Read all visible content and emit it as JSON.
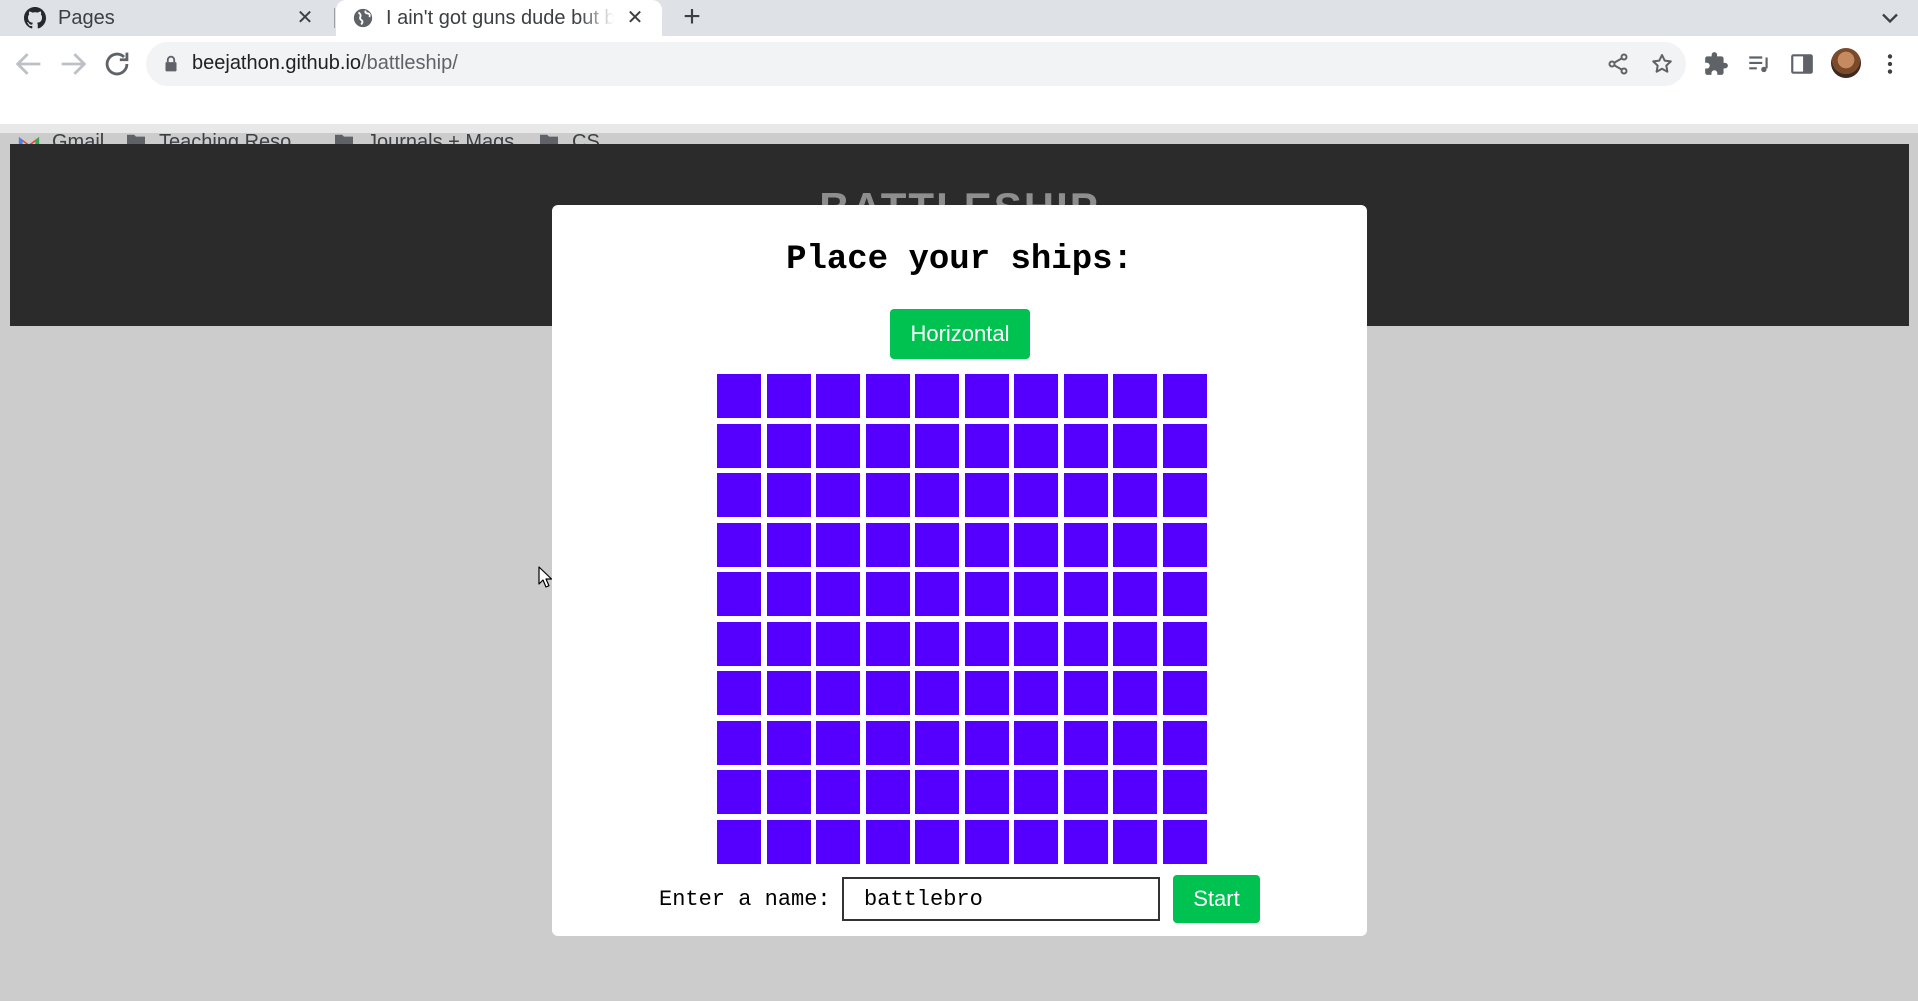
{
  "browser": {
    "tabs": [
      {
        "title": "Pages",
        "favicon": "github-icon",
        "active": false
      },
      {
        "title": "I ain't got guns dude but b",
        "favicon": "globe-icon",
        "active": true
      }
    ],
    "url": {
      "host": "beejathon.github.io",
      "path": "/battleship/"
    },
    "bookmarks": [
      {
        "label": "Gmail",
        "icon": "gmail-icon"
      },
      {
        "label": "Teaching Reso...",
        "icon": "folder-icon"
      },
      {
        "label": "Journals + Mags",
        "icon": "folder-icon"
      },
      {
        "label": "CS",
        "icon": "folder-icon"
      }
    ]
  },
  "page": {
    "site_title": "BATTLESHIP",
    "modal": {
      "title": "Place your ships:",
      "orientation_button": "Horizontal",
      "grid": {
        "rows": 10,
        "cols": 10,
        "cell_color": "#5500ff"
      },
      "name_label": "Enter a name:",
      "name_value": "battlebro",
      "start_button": "Start"
    }
  },
  "colors": {
    "accent_green": "#00c251",
    "header_bg": "#2b2b2b",
    "page_bg": "#cccccc"
  }
}
